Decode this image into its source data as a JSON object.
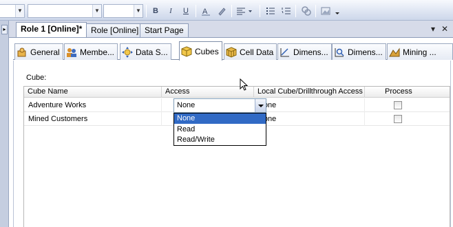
{
  "toolbar": {
    "bold_label": "B",
    "italic_label": "I",
    "underline_label": "U"
  },
  "document_tabs": [
    {
      "label": "Role 1 [Online]*",
      "active": true
    },
    {
      "label": "Role [Online]",
      "active": false
    },
    {
      "label": "Start Page",
      "active": false
    }
  ],
  "window_buttons": {
    "dropdown": "▾",
    "close": "✕"
  },
  "designer_tabs": [
    {
      "label": "General",
      "icon": "general-icon"
    },
    {
      "label": "Membe...",
      "icon": "membership-icon"
    },
    {
      "label": "Data S...",
      "icon": "data-sources-icon"
    },
    {
      "label": "Cubes",
      "icon": "cubes-icon",
      "active": true
    },
    {
      "label": "Cell Data",
      "icon": "cell-data-icon"
    },
    {
      "label": "Dimens...",
      "icon": "dimensions-icon"
    },
    {
      "label": "Dimens...",
      "icon": "dimension-data-icon"
    },
    {
      "label": "Mining ...",
      "icon": "mining-structures-icon"
    }
  ],
  "cube_section_label": "Cube:",
  "grid": {
    "columns": [
      "Cube Name",
      "Access",
      "Local Cube/Drillthrough Access",
      "Process"
    ],
    "rows": [
      {
        "cube_name": "Adventure Works",
        "access": "None",
        "local_access": "None",
        "process": false
      },
      {
        "cube_name": "Mined Customers",
        "access": "",
        "local_access": "None",
        "process": false
      }
    ]
  },
  "access_dropdown": {
    "selected": "None",
    "options": [
      "None",
      "Read",
      "Read/Write"
    ],
    "highlighted": "None"
  },
  "colors": {
    "selection": "#316ac5",
    "toolbar_bg": "#dde4f2",
    "panel_border": "#8c9bb8"
  }
}
